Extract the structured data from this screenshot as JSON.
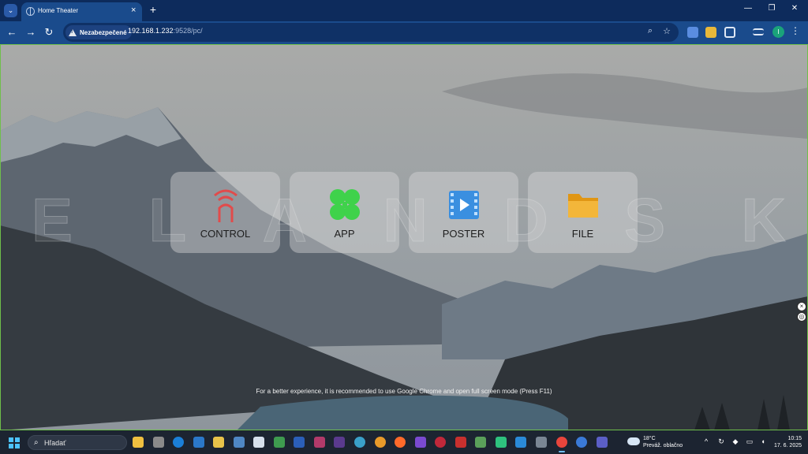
{
  "browser": {
    "tab_title": "Home Theater",
    "security_chip": "Nezabezpečené",
    "url_host": "192.168.1.232",
    "url_rest": ":9528/pc/"
  },
  "page": {
    "watermark_letters": [
      "E",
      "L",
      "A",
      "N",
      "D",
      "S",
      "K"
    ],
    "tiles": [
      {
        "label": "CONTROL",
        "icon": "remote-control-icon",
        "color": "#e14b4b"
      },
      {
        "label": "APP",
        "icon": "clover-icon",
        "color": "#3fd24b"
      },
      {
        "label": "POSTER",
        "icon": "film-play-icon",
        "color": "#3a8fe0"
      },
      {
        "label": "FILE",
        "icon": "folder-icon",
        "color": "#f0a81e"
      }
    ],
    "hint": "For a better experience, it is recommended to use Google Chrome and open full screen mode (Press F11)"
  },
  "taskbar": {
    "search_placeholder": "Hľadať",
    "weather_temp": "18°C",
    "weather_desc": "Preváž. oblačno",
    "time": "10:15",
    "date": "17. 6. 2025"
  }
}
